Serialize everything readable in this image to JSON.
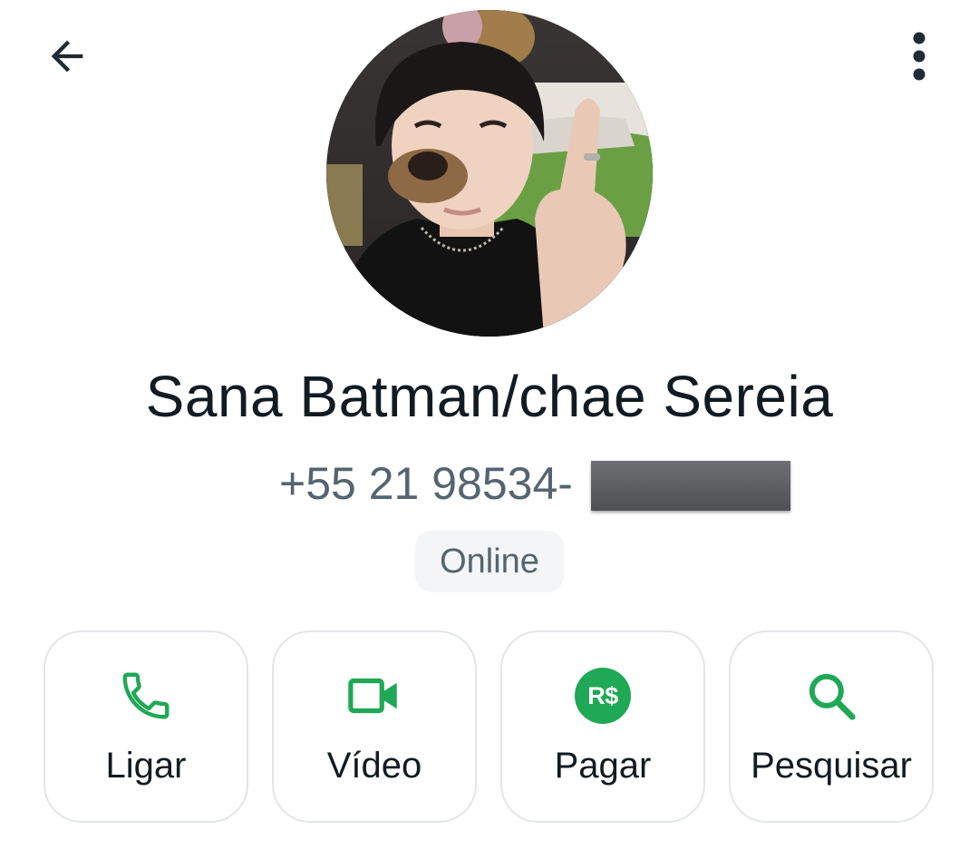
{
  "header": {
    "back_icon": "arrow-left-icon",
    "menu_icon": "more-vertical-icon"
  },
  "profile": {
    "photo": "profile-photo",
    "name": "Sana Batman/chae Sereia",
    "phone_visible": "+55 21 98534-",
    "status": "Online"
  },
  "actions": [
    {
      "label": "Ligar",
      "icon": "phone-icon"
    },
    {
      "label": "Vídeo",
      "icon": "video-camera-icon"
    },
    {
      "label": "Pagar",
      "icon": "brazilian-real-icon",
      "icon_text": "R$"
    },
    {
      "label": "Pesquisar",
      "icon": "search-icon"
    }
  ],
  "colors": {
    "accent": "#1fa855",
    "text_primary": "#111b21",
    "text_secondary": "#54656f",
    "button_border": "#e3e6e8",
    "pill_bg": "#f3f5f6"
  }
}
